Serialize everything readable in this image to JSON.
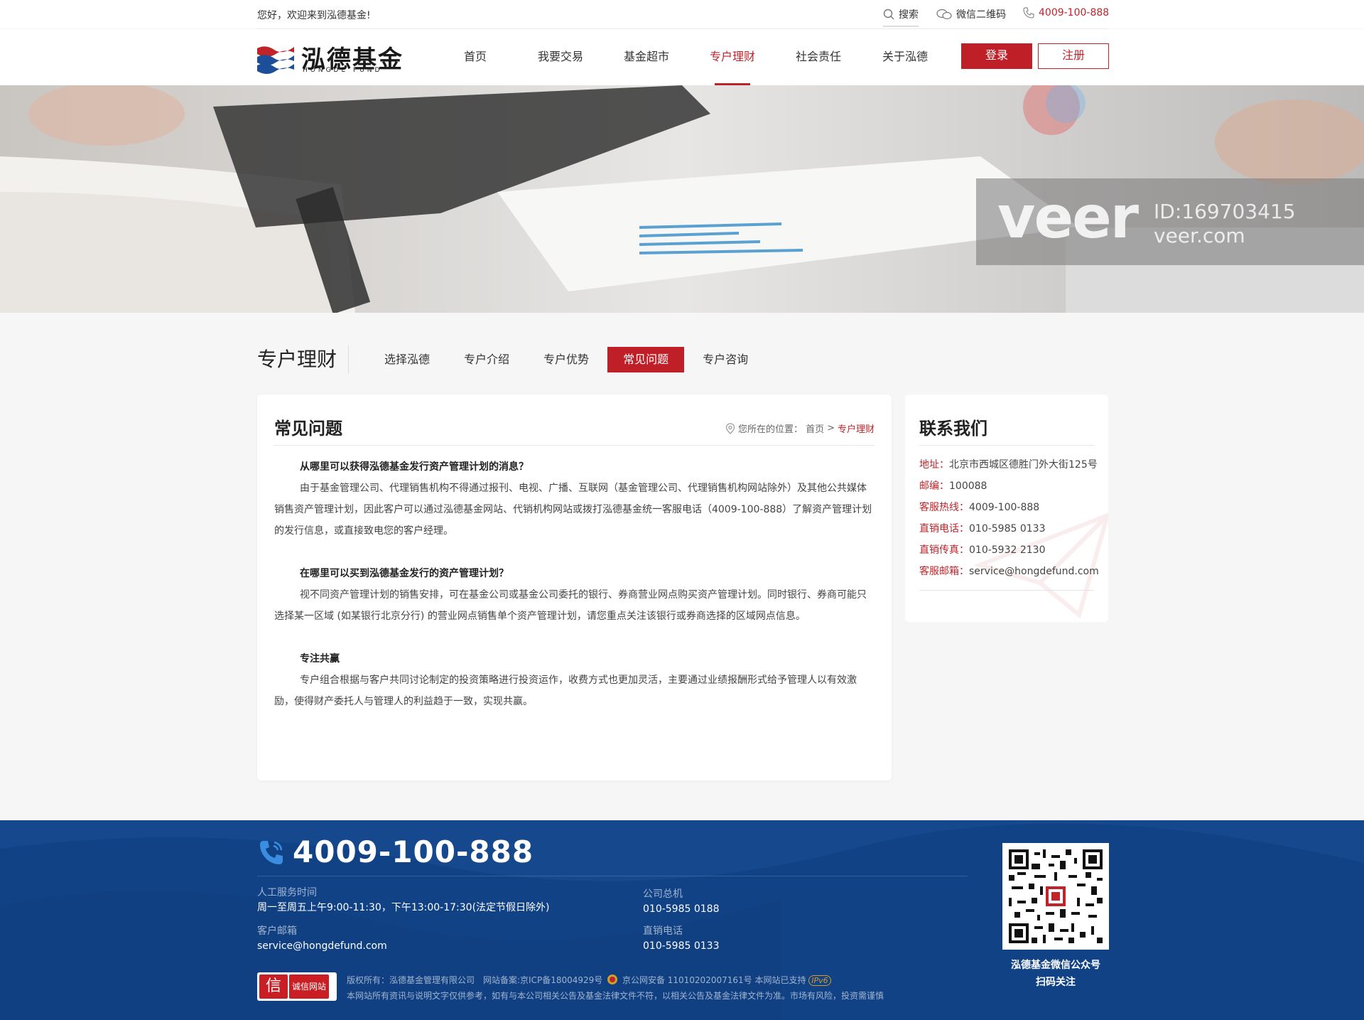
{
  "topbar": {
    "welcome": "您好，欢迎来到泓德基金!",
    "search_label": "搜索",
    "wechat_label": "微信二维码",
    "phone": "4009-100-888"
  },
  "header": {
    "logo_cn": "泓德基金",
    "logo_en": "HONGDE FUND",
    "nav": [
      {
        "label": "首页",
        "active": false
      },
      {
        "label": "我要交易",
        "active": false
      },
      {
        "label": "基金超市",
        "active": false
      },
      {
        "label": "专户理财",
        "active": true
      },
      {
        "label": "社会责任",
        "active": false
      },
      {
        "label": "关于泓德",
        "active": false
      }
    ],
    "login_label": "登录",
    "register_label": "注册"
  },
  "banner": {
    "watermark_brand": "veer",
    "watermark_id": "ID:169703415",
    "watermark_url": "veer.com"
  },
  "subnav": {
    "section_title": "专户理财",
    "items": [
      {
        "label": "选择泓德",
        "active": false
      },
      {
        "label": "专户介绍",
        "active": false
      },
      {
        "label": "专户优势",
        "active": false
      },
      {
        "label": "常见问题",
        "active": true
      },
      {
        "label": "专户咨询",
        "active": false
      }
    ]
  },
  "main": {
    "title": "常见问题",
    "breadcrumb": {
      "prefix": "您所在的位置：",
      "home": "首页",
      "separator": ">",
      "current": "专户理财"
    },
    "faqs": [
      {
        "question": "从哪里可以获得泓德基金发行资产管理计划的消息？",
        "answer": "由于基金管理公司、代理销售机构不得通过报刊、电视、广播、互联网（基金管理公司、代理销售机构网站除外）及其他公共媒体销售资产管理计划，因此客户可以通过泓德基金网站、代销机构网站或拨打泓德基金统一客服电话（4009-100-888）了解资产管理计划的发行信息，或直接致电您的客户经理。"
      },
      {
        "question": "在哪里可以买到泓德基金发行的资产管理计划？",
        "answer": "视不同资产管理计划的销售安排，可在基金公司或基金公司委托的银行、券商营业网点购买资产管理计划。同时银行、券商可能只选择某一区域 (如某银行北京分行) 的营业网点销售单个资产管理计划，请您重点关注该银行或券商选择的区域网点信息。"
      },
      {
        "question": "专注共赢",
        "answer": "专户组合根据与客户共同讨论制定的投资策略进行投资运作，收费方式也更加灵活，主要通过业绩报酬形式给予管理人以有效激励，使得财产委托人与管理人的利益趋于一致，实现共赢。"
      }
    ]
  },
  "contact": {
    "title": "联系我们",
    "rows": [
      {
        "label": "地址：",
        "value": "北京市西城区德胜门外大街125号"
      },
      {
        "label": "邮编：",
        "value": "100088"
      },
      {
        "label": "客服热线：",
        "value": "4009-100-888"
      },
      {
        "label": "直销电话：",
        "value": "010-5985 0133"
      },
      {
        "label": "直销传真：",
        "value": "010-5932 2130"
      },
      {
        "label": "客服邮箱：",
        "value": "service@hongdefund.com"
      }
    ]
  },
  "footer": {
    "hotline": "4009-100-888",
    "service_hours_label": "人工服务时间",
    "service_hours": "周一至周五上午9:00-11:30，下午13:00-17:30(法定节假日除外)",
    "email_label": "客户邮箱",
    "email": "service@hongdefund.com",
    "switchboard_label": "公司总机",
    "switchboard": "010-5985 0188",
    "direct_label": "直销电话",
    "direct": "010-5985 0133",
    "badge_icon": "信",
    "badge_text": "诚信网站",
    "legal_line1": "版权所有：泓德基金管理有限公司　网站备案:京ICP备18004929号",
    "legal_police": "京公网安备 11010202007161号 本网站已支持",
    "ipv6": "IPv6",
    "legal_line2": "本网站所有资讯与说明文字仅供参考，如有与本公司相关公告及基金法律文件不符，以相关公告及基金法律文件为准。市场有风险，投资需谨慎",
    "qr_caption_1": "泓德基金微信公众号",
    "qr_caption_2": "扫码关注"
  },
  "colors": {
    "brand_red": "#c0242b",
    "footer_blue": "#114286",
    "page_bg": "#f6f6f6"
  }
}
